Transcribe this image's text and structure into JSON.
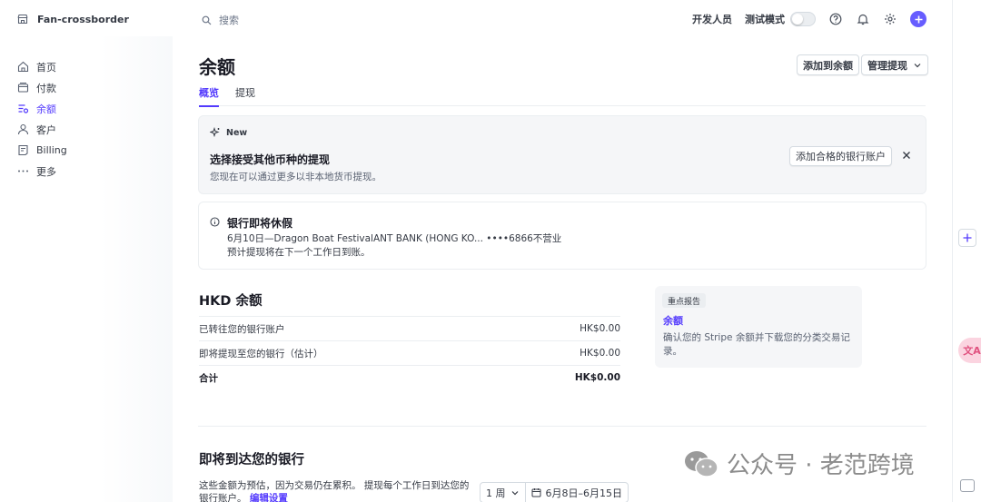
{
  "sidebar": {
    "account_name": "Fan-crossborder",
    "items": [
      {
        "label": "首页",
        "icon": "home-icon",
        "active": false
      },
      {
        "label": "付款",
        "icon": "payments-icon",
        "active": false
      },
      {
        "label": "余额",
        "icon": "balances-icon",
        "active": true
      },
      {
        "label": "客户",
        "icon": "customer-icon",
        "active": false
      },
      {
        "label": "Billing",
        "icon": "billing-icon",
        "active": false
      },
      {
        "label": "更多",
        "icon": "more-icon",
        "active": false
      }
    ]
  },
  "topbar": {
    "search_placeholder": "搜索",
    "developers_label": "开发人员",
    "test_mode_label": "测试模式",
    "test_mode_on": false
  },
  "page": {
    "title": "余额",
    "add_balance_label": "添加到余额",
    "manage_payouts_label": "管理提现",
    "tabs": [
      {
        "label": "概览",
        "active": true
      },
      {
        "label": "提现",
        "active": false
      }
    ]
  },
  "new_card": {
    "tag": "New",
    "title": "选择接受其他币种的提现",
    "description": "您现在可以通过更多以非本地货币提现。",
    "button_label": "添加合格的银行账户"
  },
  "holiday_card": {
    "title": "银行即将休假",
    "line1": "6月10日—Dragon Boat FestivalANT BANK (HONG KO... ••••6866不营业",
    "line2": "预计提现将在下一个工作日到账。"
  },
  "hkd_balance": {
    "title": "HKD 余额",
    "rows": [
      {
        "label": "已转往您的银行账户",
        "amount": "HK$0.00"
      },
      {
        "label": "即将提现至您的银行（估计）",
        "amount": "HK$0.00"
      }
    ],
    "total": {
      "label": "合计",
      "amount": "HK$0.00"
    }
  },
  "report_card": {
    "badge": "重点报告",
    "link": "余额",
    "description": "确认您的 Stripe 余额并下载您的分类交易记录。"
  },
  "upcoming": {
    "title": "即将到达您的银行",
    "description": "这些金额为预估，因为交易仍在累积。 提现每个工作日到达您的银行账户。",
    "edit_link": "编辑设置",
    "period_label": "1 周",
    "date_range": "6月8日–6月15日"
  },
  "watermark": {
    "text": "公众号 · 老范跨境"
  },
  "translate_badge": "文A",
  "colors": {
    "accent": "#533afd",
    "primary_button": "#675dff",
    "card_bg": "#f5f6f8",
    "border": "#ebeef1"
  }
}
